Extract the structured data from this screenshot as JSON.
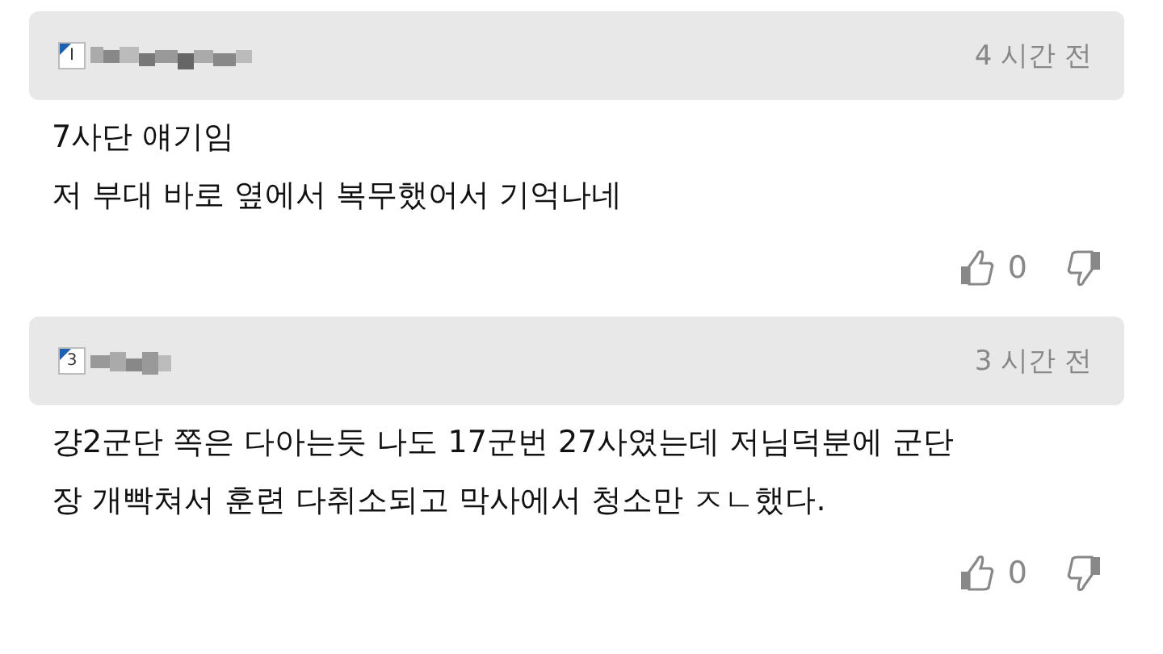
{
  "comments": [
    {
      "level_badge": "I",
      "time": "4 시간 전",
      "lines": [
        "7사단 얘기임",
        "저 부대 바로 옆에서 복무했어서 기억나네"
      ],
      "likes": "0"
    },
    {
      "level_badge": "3",
      "time": "3 시간 전",
      "lines": [
        "걍2군단 쪽은 다아는듯 나도 17군번 27사였는데 저님덕분에 군단",
        "장 개빡쳐서 훈련 다취소되고 막사에서 청소만 ㅈㄴ했다."
      ],
      "likes": "0"
    }
  ]
}
